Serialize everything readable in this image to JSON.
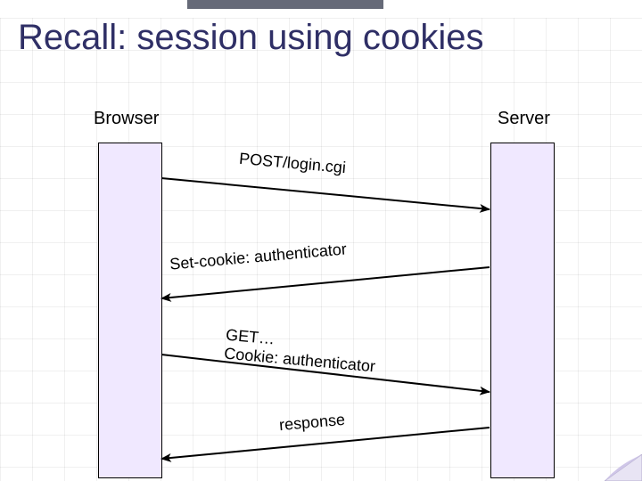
{
  "title": "Recall: session using cookies",
  "browser_label": "Browser",
  "server_label": "Server",
  "messages": {
    "m1": "POST/login.cgi",
    "m2": "Set-cookie: authenticator",
    "m3": "GET…\nCookie: authenticator",
    "m4": "response"
  },
  "colors": {
    "title": "#2f2f66",
    "box_fill": "#f0e8ff",
    "top_bar": "#666a78"
  }
}
